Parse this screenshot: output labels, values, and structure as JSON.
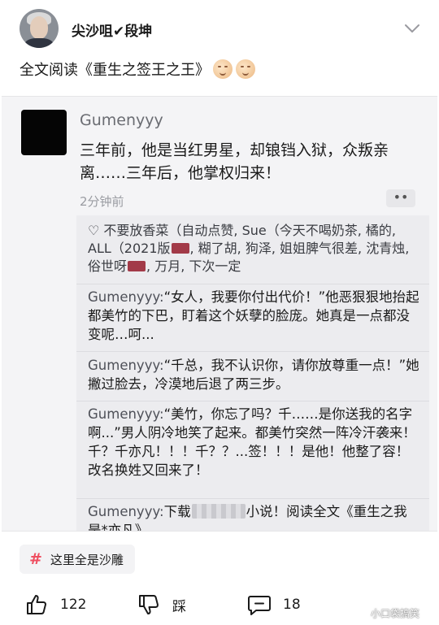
{
  "header": {
    "username": "尖沙咀✔段坤",
    "icons": {
      "avatar": "avatar",
      "menu": "chevron-down-icon"
    }
  },
  "post": {
    "text": "全文阅读《重生之签王之王》",
    "emoji_count": 2,
    "emoji_icon": "smirk-emoji"
  },
  "screenshot": {
    "author": "Gumenyyy",
    "body": "三年前，他是当红男星，却锒铛入狱，众叛亲离……三年后，他掌权归来！",
    "time": "2分钟前",
    "more": "••",
    "likes_prefix": "♡ 不要放香菜（自动点赞, Sue（今天不喝奶茶, 橘的, ALL（2021版",
    "likes_mid1": ", 糊了胡, 狗泽, 姐姐脾气很差, 沈青烛, 俗世呀",
    "likes_mid2": ", 万月, 下次一定",
    "comments": [
      {
        "name": "Gumenyyy:",
        "text": "“女人，我要你付出代价！”他恶狠狠地抬起都美竹的下巴，盯着这个妖孽的脸庞。她真是一点都没变呢…呵..."
      },
      {
        "name": "Gumenyyy:",
        "text": "“千总，我不认识你，请你放尊重一点！”她撇过脸去，冷漠地后退了两三步。"
      },
      {
        "name": "Gumenyyy:",
        "text": "“美竹，你忘了吗？千……是你送我的名字啊...”男人阴冷地笑了起来。都美竹突然一阵冷汗袭来！千？千亦凡！！！千？？...签！！！是他！他整了容！改名换姓又回来了！"
      },
      {
        "name": "Gumenyyy:",
        "text_a": "下载",
        "text_b": "小说！阅读全文《重生之我是*亦凡》"
      }
    ]
  },
  "footer": {
    "tag": "这里全是沙雕",
    "tag_icon": "hash-icon",
    "like_count": "122",
    "dislike_label": "踩",
    "comment_count": "18",
    "watermark": "小口袋搞笑",
    "colors": {
      "tag_hash": "#ef4e60",
      "blot": "#a23a48"
    }
  }
}
